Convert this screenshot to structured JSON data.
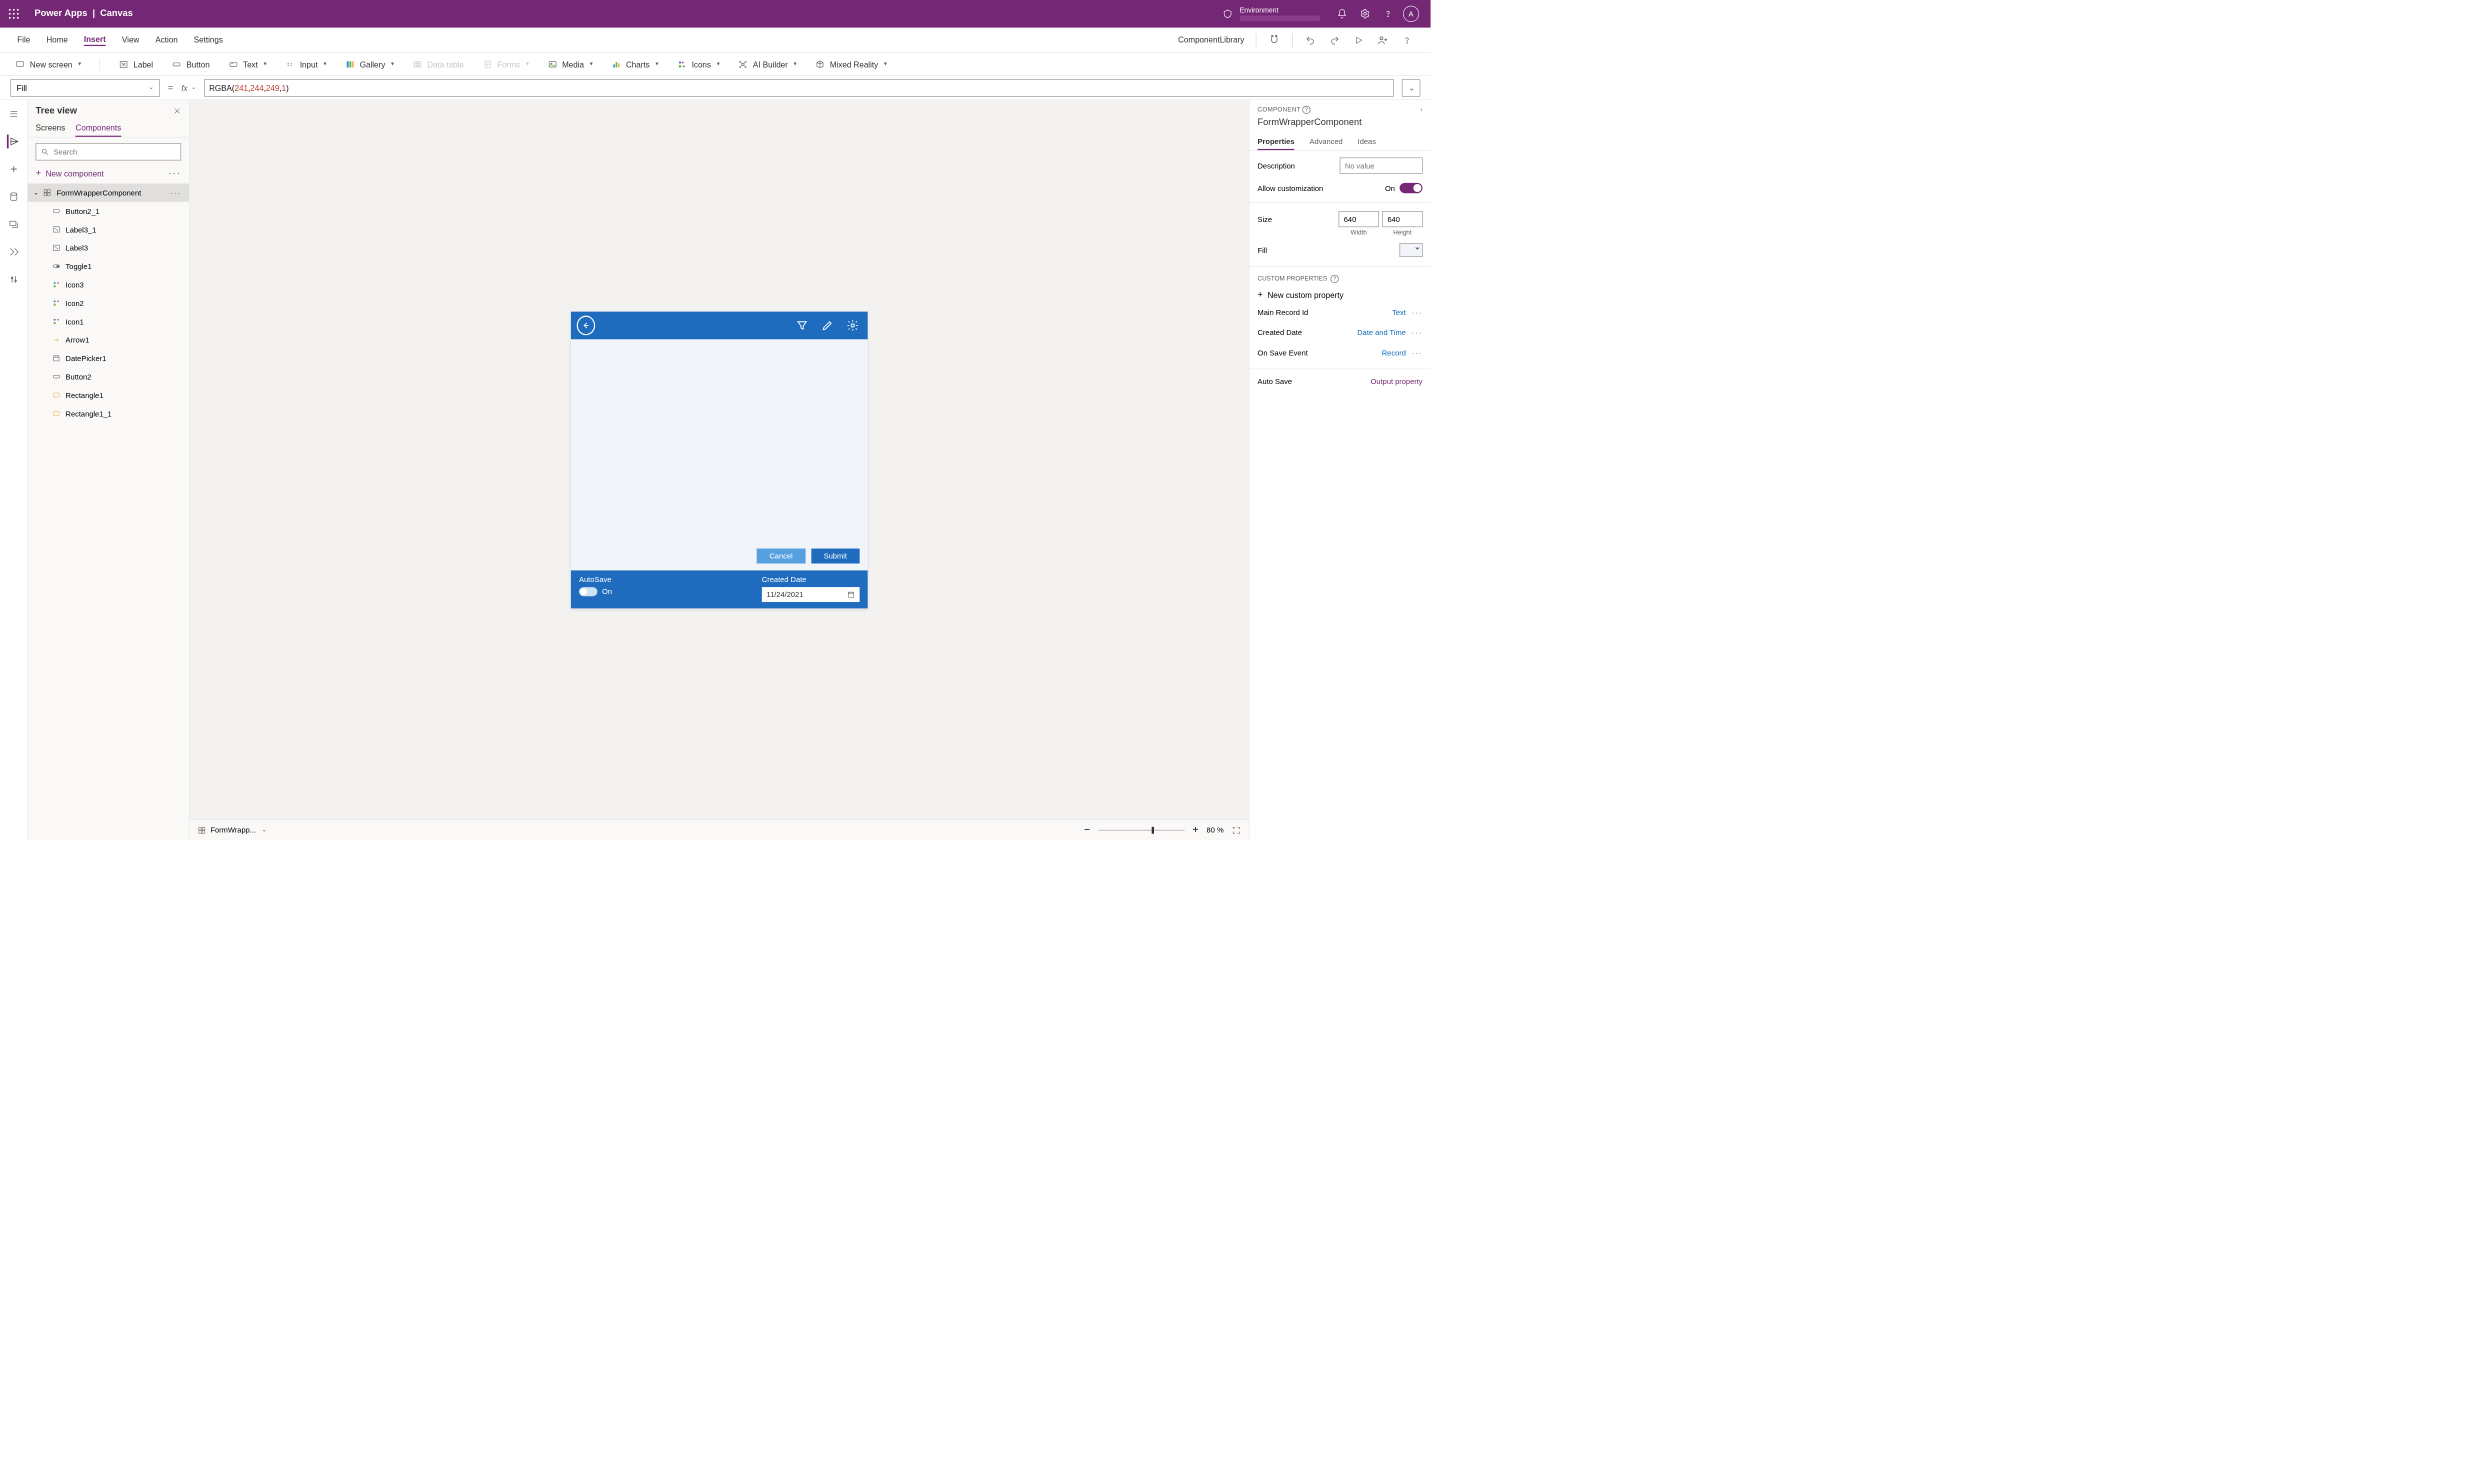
{
  "titlebar": {
    "app": "Power Apps",
    "section": "Canvas",
    "environment_label": "Environment",
    "avatar_initial": "A"
  },
  "menubar": {
    "items": [
      "File",
      "Home",
      "Insert",
      "View",
      "Action",
      "Settings"
    ],
    "active_index": 2,
    "component_library": "ComponentLibrary"
  },
  "ribbon": {
    "new_screen": "New screen",
    "label": "Label",
    "button": "Button",
    "text": "Text",
    "input": "Input",
    "gallery": "Gallery",
    "data_table": "Data table",
    "forms": "Forms",
    "media": "Media",
    "charts": "Charts",
    "icons": "Icons",
    "ai_builder": "AI Builder",
    "mixed_reality": "Mixed Reality"
  },
  "formula": {
    "property": "Fill",
    "value": "RGBA(241, 244, 249, 1)"
  },
  "tree": {
    "title": "Tree view",
    "tabs": [
      "Screens",
      "Components"
    ],
    "active_tab": 1,
    "search_placeholder": "Search",
    "new_component": "New component",
    "root": "FormWrapperComponent",
    "children": [
      "Button2_1",
      "Label3_1",
      "Label3",
      "Toggle1",
      "Icon3",
      "Icon2",
      "Icon1",
      "Arrow1",
      "DatePicker1",
      "Button2",
      "Rectangle1",
      "Rectangle1_1"
    ]
  },
  "canvas": {
    "autosave_label": "AutoSave",
    "autosave_state": "On",
    "created_label": "Created Date",
    "created_value": "11/24/2021",
    "cancel": "Cancel",
    "submit": "Submit",
    "footer_selected": "FormWrapp...",
    "zoom_value": "80",
    "zoom_unit": "%"
  },
  "props": {
    "kind": "COMPONENT",
    "name": "FormWrapperComponent",
    "tabs": [
      "Properties",
      "Advanced",
      "Ideas"
    ],
    "active_tab": 0,
    "description_label": "Description",
    "description_placeholder": "No value",
    "allow_custom_label": "Allow customization",
    "allow_custom_state": "On",
    "size_label": "Size",
    "size_w": "640",
    "size_h": "640",
    "width_label": "Width",
    "height_label": "Height",
    "fill_label": "Fill",
    "custom_title": "CUSTOM PROPERTIES",
    "new_custom": "New custom property",
    "custom_props": [
      {
        "name": "Main Record Id",
        "type": "Text",
        "color": "blue"
      },
      {
        "name": "Created Date",
        "type": "Date and Time",
        "color": "blue"
      },
      {
        "name": "On Save Event",
        "type": "Record",
        "color": "blue"
      },
      {
        "name": "Auto Save",
        "type": "Output property",
        "color": "purple"
      }
    ]
  }
}
